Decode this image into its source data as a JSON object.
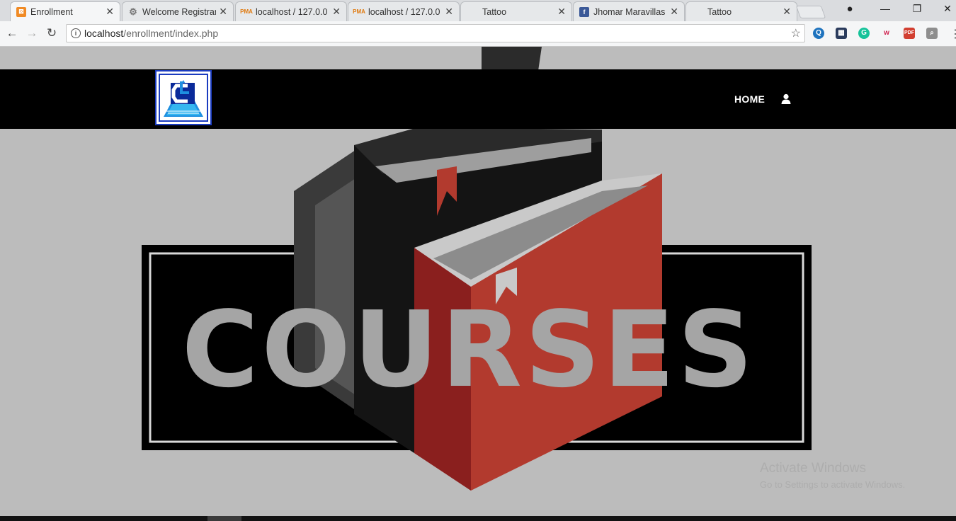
{
  "browser": {
    "tabs": [
      {
        "title": "Enrollment",
        "favicon": "xampp-icon",
        "active": true
      },
      {
        "title": "Welcome Registrar",
        "favicon": "gear-icon",
        "active": false
      },
      {
        "title": "localhost / 127.0.0",
        "favicon": "phpmyadmin-icon",
        "active": false
      },
      {
        "title": "localhost / 127.0.0",
        "favicon": "phpmyadmin-icon",
        "active": false
      },
      {
        "title": "Tattoo",
        "favicon": "",
        "active": false
      },
      {
        "title": "Jhomar Maravillas",
        "favicon": "facebook-icon",
        "active": false
      },
      {
        "title": "Tattoo",
        "favicon": "",
        "active": false
      }
    ],
    "url_host": "localhost",
    "url_path": "/enrollment/index.php"
  },
  "site": {
    "nav_home": "HOME",
    "hero_text": "COURSES"
  },
  "windows": {
    "watermark_title": "Activate Windows",
    "watermark_sub": "Go to Settings to activate Windows."
  },
  "colors": {
    "book_red": "#b23a2e",
    "nav_bg": "#000000",
    "logo_blue": "#1a3bbf"
  }
}
